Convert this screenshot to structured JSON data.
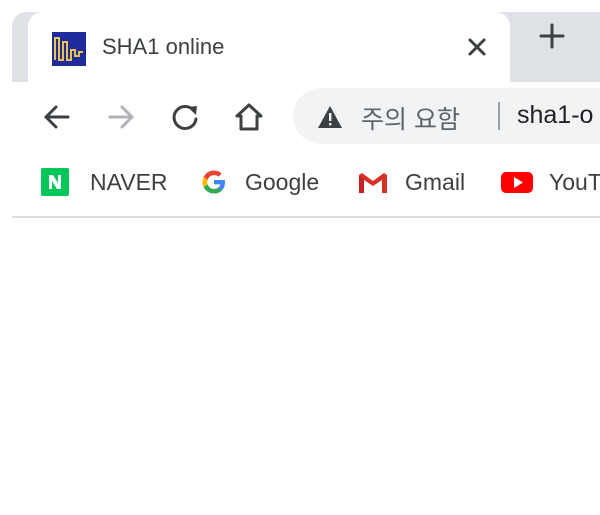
{
  "tab": {
    "title": "SHA1 online",
    "favicon": "sha1-online-favicon",
    "close_icon": "close-icon"
  },
  "new_tab_icon": "plus-icon",
  "toolbar": {
    "back_icon": "arrow-left-icon",
    "forward_icon": "arrow-right-icon",
    "reload_icon": "reload-icon",
    "home_icon": "home-icon"
  },
  "omnibox": {
    "security_icon": "warning-triangle-icon",
    "security_label": "주의 요함",
    "url": "sha1-o"
  },
  "bookmarks": [
    {
      "label": "NAVER",
      "icon": "naver-icon"
    },
    {
      "label": "Google",
      "icon": "google-icon"
    },
    {
      "label": "Gmail",
      "icon": "gmail-icon"
    },
    {
      "label": "YouT",
      "icon": "youtube-icon"
    }
  ],
  "colors": {
    "tabstrip_bg": "#dee1e6",
    "omnibox_bg": "#f1f3f4",
    "naver_green": "#03c75a",
    "youtube_red": "#ff0000",
    "forward_disabled": "#b0b3b8"
  }
}
